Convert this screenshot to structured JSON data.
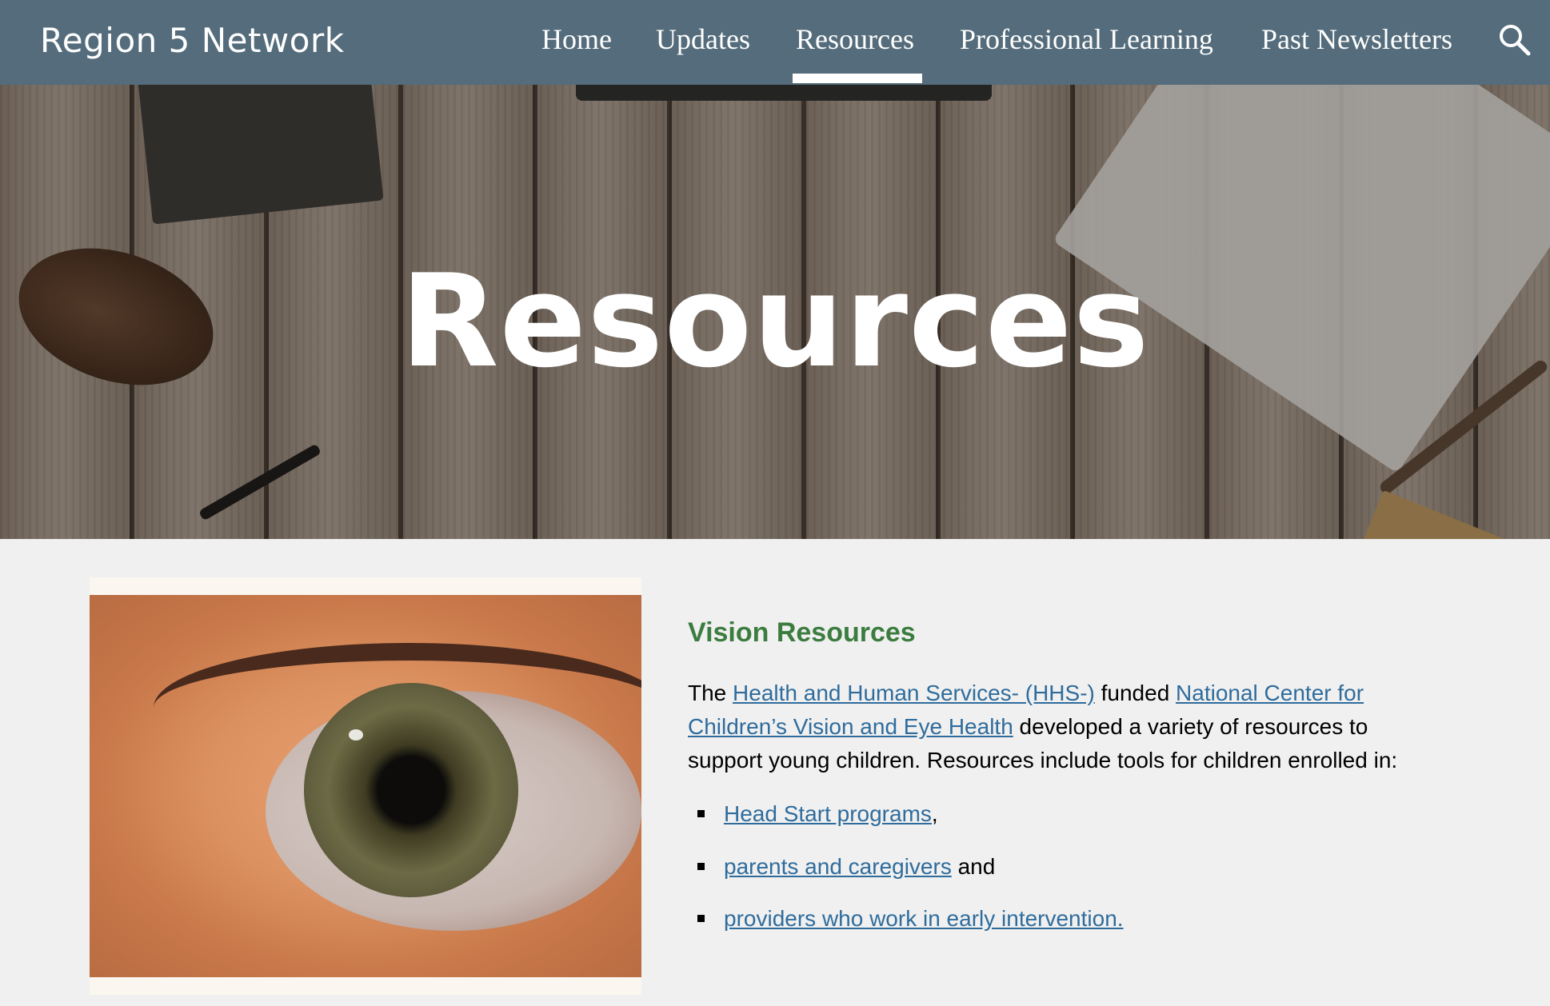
{
  "header": {
    "site_title": "Region 5 Network",
    "nav": {
      "home": "Home",
      "updates": "Updates",
      "resources": "Resources",
      "professional_learning": "Professional Learning",
      "past_newsletters": "Past Newsletters"
    },
    "active_nav": "Resources",
    "search_icon": "search-icon"
  },
  "hero": {
    "title": "Resources"
  },
  "content": {
    "heading": "Vision Resources",
    "para": {
      "the": "The",
      "hhs_link": "Health and Human Services- (HHS-)",
      "funded": "funded",
      "ncvh_link_1": "National Center for",
      "ncvh_link_2": "Children’s Vision and Eye Health",
      "after_link": "developed a variety of resources to",
      "line3": "support young children. Resources include tools for children enrolled in:"
    },
    "bullets": [
      {
        "link": "Head Start programs",
        "after": ","
      },
      {
        "link": "parents and caregivers",
        "after": " and"
      },
      {
        "link": "providers who work in early intervention.",
        "after": ""
      }
    ]
  },
  "colors": {
    "header_bg": "#546c7b",
    "heading_green": "#3b7c3f",
    "link_blue": "#2f6c9c",
    "page_bg": "#f0f0f0"
  }
}
